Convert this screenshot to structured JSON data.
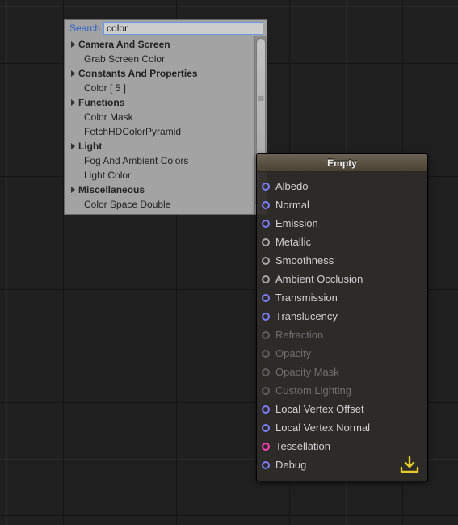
{
  "search": {
    "label": "Search",
    "value": "color"
  },
  "tree": {
    "categories": [
      {
        "label": "Camera And Screen",
        "children": [
          "Grab Screen Color"
        ]
      },
      {
        "label": "Constants And Properties",
        "children": [
          "Color [ 5 ]"
        ]
      },
      {
        "label": "Functions",
        "children": [
          "Color Mask",
          "FetchHDColorPyramid"
        ]
      },
      {
        "label": "Light",
        "children": [
          "Fog And Ambient Colors",
          "Light Color"
        ]
      },
      {
        "label": "Miscellaneous",
        "children": [
          "Color Space Double"
        ]
      }
    ]
  },
  "node": {
    "title": "Empty",
    "ports": [
      {
        "label": "Albedo",
        "color": "#7d7dff",
        "enabled": true
      },
      {
        "label": "Normal",
        "color": "#7d7dff",
        "enabled": true
      },
      {
        "label": "Emission",
        "color": "#7d7dff",
        "enabled": true
      },
      {
        "label": "Metallic",
        "color": "#a6a6a6",
        "enabled": true
      },
      {
        "label": "Smoothness",
        "color": "#a6a6a6",
        "enabled": true
      },
      {
        "label": "Ambient Occlusion",
        "color": "#a6a6a6",
        "enabled": true
      },
      {
        "label": "Transmission",
        "color": "#7d7dff",
        "enabled": true
      },
      {
        "label": "Translucency",
        "color": "#7d7dff",
        "enabled": true
      },
      {
        "label": "Refraction",
        "color": "#5f5f5f",
        "enabled": false
      },
      {
        "label": "Opacity",
        "color": "#5f5f5f",
        "enabled": false
      },
      {
        "label": "Opacity Mask",
        "color": "#5f5f5f",
        "enabled": false
      },
      {
        "label": "Custom Lighting",
        "color": "#5f5f5f",
        "enabled": false
      },
      {
        "label": "Local Vertex Offset",
        "color": "#7d7dff",
        "enabled": true
      },
      {
        "label": "Local Vertex Normal",
        "color": "#7d7dff",
        "enabled": true
      },
      {
        "label": "Tessellation",
        "color": "#ff3fb3",
        "enabled": true
      },
      {
        "label": "Debug",
        "color": "#7d7dff",
        "enabled": true
      }
    ]
  },
  "accent": {
    "save_icon": "#e5cc2b"
  }
}
